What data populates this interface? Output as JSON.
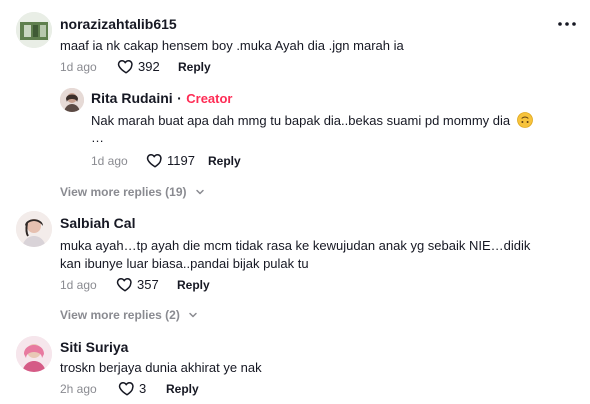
{
  "comments": [
    {
      "username": "norazizahtalib615",
      "text": "maaf ia nk cakap hensem boy .muka Ayah dia .jgn marah ia",
      "time": "1d ago",
      "likes": "392",
      "reply_label": "Reply"
    },
    {
      "username": "Salbiah Cal",
      "text_line1": "muka ayah…tp ayah die mcm tidak rasa ke kewujudan anak yg sebaik NIE…didik",
      "text_line2": "kan ibunye luar biasa..pandai bijak pulak tu",
      "time": "1d ago",
      "likes": "357",
      "reply_label": "Reply"
    },
    {
      "username": "Siti Suriya",
      "text": "troskn berjaya dunia akhirat ye nak",
      "time": "2h ago",
      "likes": "3",
      "reply_label": "Reply"
    }
  ],
  "reply": {
    "username": "Rita Rudaini",
    "separator": "·",
    "badge": "Creator",
    "text": "Nak marah buat apa dah mmg tu bapak dia..bekas suami pd mommy dia",
    "ellipsis": "…",
    "time": "1d ago",
    "likes": "1197",
    "reply_label": "Reply"
  },
  "view_more": [
    {
      "label": "View more replies (19)"
    },
    {
      "label": "View more replies (2)"
    }
  ],
  "icons": {
    "menu": "more-dots-icon",
    "like": "heart-outline-icon",
    "expand": "chevron-down-icon",
    "emoji": "upside-down-face-emoji"
  },
  "colors": {
    "creator": "#fe2c55",
    "secondary_text": "#8a8b91",
    "primary_text": "#161823"
  }
}
